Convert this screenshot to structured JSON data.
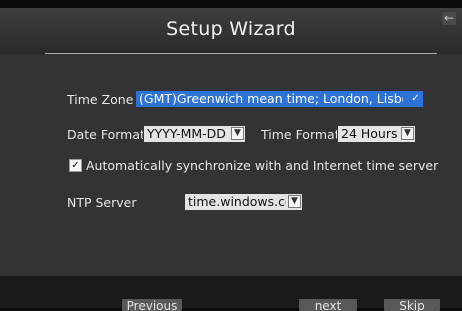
{
  "window": {
    "title": "Setup Wizard"
  },
  "form": {
    "time_zone_label": "Time Zone",
    "time_zone_value": "(GMT)Greenwich mean time; London, Lisbon",
    "date_format_label": "Date Format",
    "date_format_value": "YYYY-MM-DD",
    "time_format_label": "Time Format",
    "time_format_value": "24 Hours",
    "sync_label": "Automatically synchronize with and Internet time server",
    "sync_checked": true,
    "ntp_server_label": "NTP Server",
    "ntp_server_value": "time.windows.com"
  },
  "buttons": {
    "previous": "Previous",
    "next": "next",
    "skip": "Skip"
  },
  "icons": {
    "back": "back-arrow-icon",
    "dropdown": "chevron-down-icon",
    "check": "check-icon"
  },
  "colors": {
    "selected_field": "#2d72d6",
    "field_bg": "#e4e4e4",
    "panel_bg": "#333335"
  }
}
